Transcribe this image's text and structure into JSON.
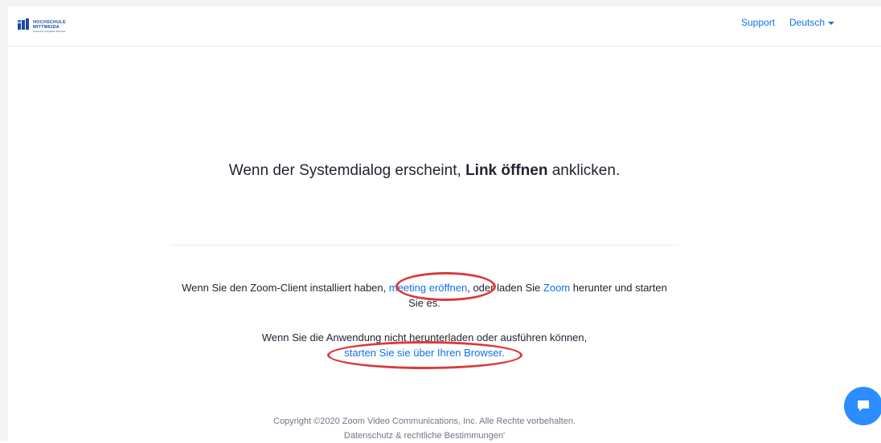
{
  "header": {
    "logo": {
      "line1": "HOCHSCHULE",
      "line2": "MITTWEIDA",
      "subline": "University of Applied Sciences"
    },
    "nav": {
      "support": "Support",
      "language": "Deutsch"
    }
  },
  "main": {
    "headline": {
      "before": "Wenn der Systemdialog erscheint, ",
      "bold": "Link öffnen",
      "after": " anklicken."
    },
    "launch_paragraph": {
      "text1": "Wenn Sie den Zoom-Client installiert haben, ",
      "link1": "meeting eröffnen",
      "text2": ", oder laden Sie ",
      "link2": "Zoom",
      "text3": " herunter und starten Sie es."
    },
    "browser_paragraph": {
      "text1": "Wenn Sie die Anwendung nicht herunterladen oder ausführen können,",
      "link1": "starten Sie sie über Ihren Browser."
    }
  },
  "footer": {
    "copyright": "Copyright ©2020 Zoom Video Communications, Inc. Alle Rechte vorbehalten.",
    "legal": "Datenschutz & rechtliche Bestimmungen'"
  },
  "icons": {
    "logo": "university-logo",
    "language_caret": "caret-down",
    "chat": "chat-bubble-icon"
  },
  "colors": {
    "link": "#0e72ed",
    "annotation": "#d93a3a",
    "chat_button": "#2d8cff",
    "text": "#232333"
  }
}
